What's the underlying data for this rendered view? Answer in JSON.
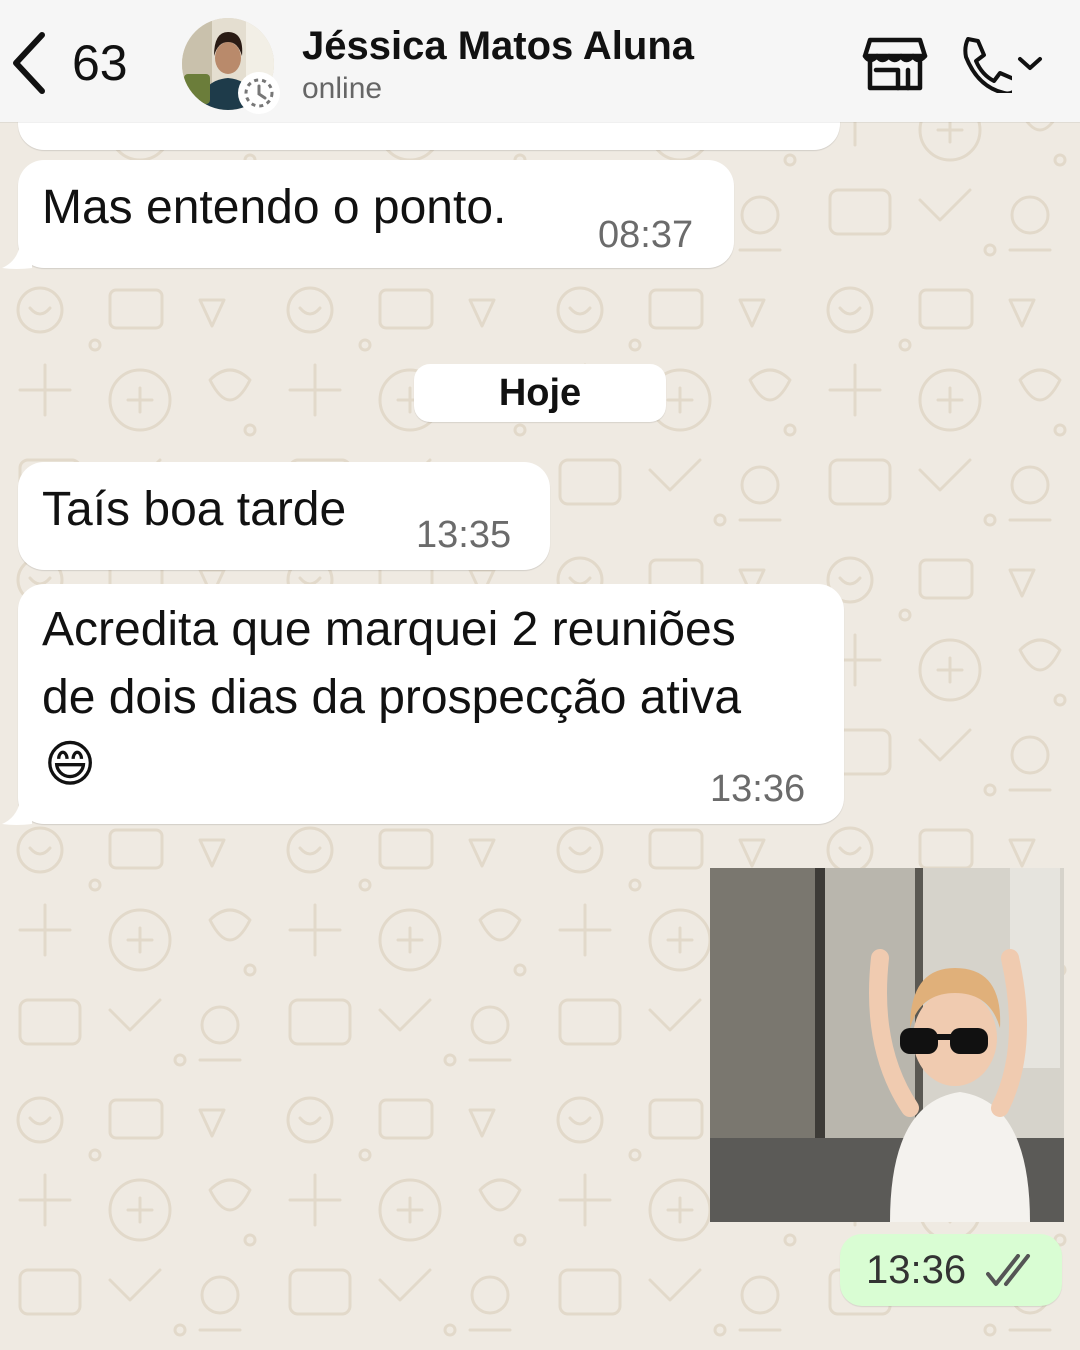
{
  "header": {
    "unread_count": "63",
    "contact_name": "Jéssica Matos Aluna",
    "contact_status": "online"
  },
  "messages": [
    {
      "direction": "in",
      "text": "Mas entendo o ponto.",
      "time": "08:37"
    },
    {
      "direction": "in",
      "text": "Taís boa tarde",
      "time": "13:35"
    },
    {
      "direction": "in",
      "text_line1": "Acredita que marquei 2 reuniões",
      "text_line2": "de dois dias da prospecção ativa",
      "emoji": "😄",
      "time": "13:36"
    },
    {
      "direction": "out",
      "type": "image",
      "time": "13:36",
      "status": "read"
    }
  ],
  "date_divider": "Hoje",
  "colors": {
    "chat_background": "#efeae2",
    "incoming_bubble": "#ffffff",
    "outgoing_bubble": "#d9fdd3",
    "header_background": "#f6f6f6"
  },
  "icons": [
    "chevron-left-icon",
    "status-icon",
    "store-icon",
    "phone-icon",
    "chevron-down-icon",
    "double-check-icon"
  ]
}
